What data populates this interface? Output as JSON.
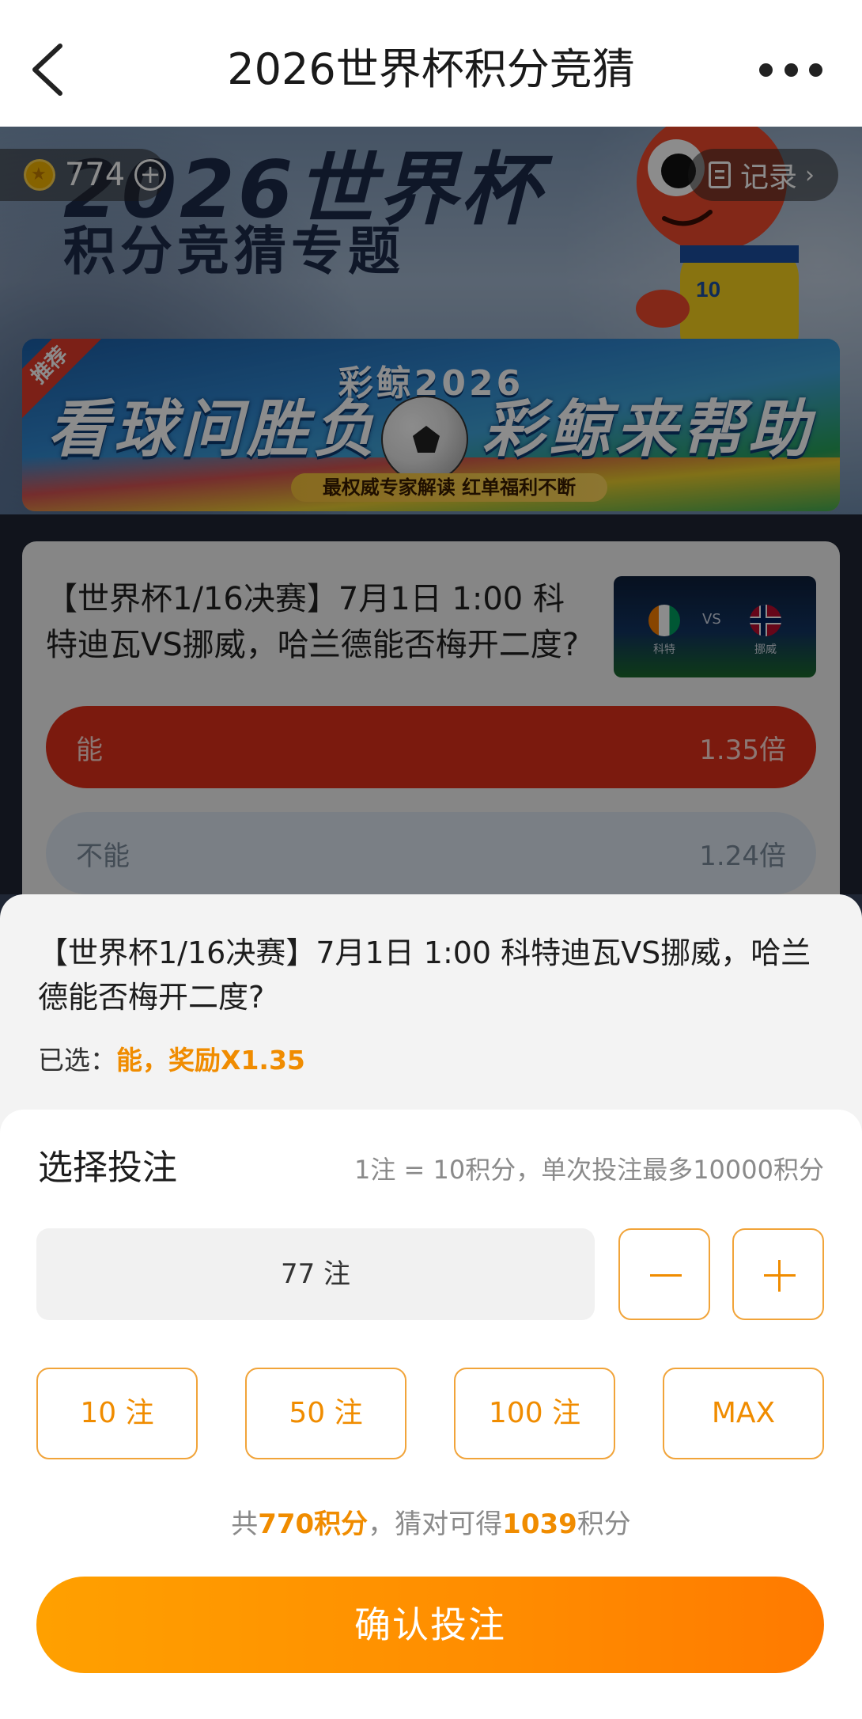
{
  "nav": {
    "title": "2026世界杯积分竞猜",
    "back_icon": "chevron-left-icon",
    "more_icon": "more-horizontal-icon"
  },
  "hero": {
    "points": "774",
    "record_label": "记录",
    "title_line1": "2026世界杯",
    "title_line2": "积分竞猜专题",
    "banner_tag": "推荐",
    "banner_sub": "彩鲸2026",
    "banner_main_left": "看球问胜负",
    "banner_main_right": "彩鲸来帮助",
    "banner_pill": "最权威专家解读 红单福利不断"
  },
  "question_card": {
    "title": "【世界杯1/16决赛】7月1日 1:00 科特迪瓦VS挪威，哈兰德能否梅开二度?",
    "thumb_vs": "VS",
    "thumb_team1": "科特",
    "thumb_team2": "挪威",
    "options": [
      {
        "label": "能",
        "odds": "1.35倍"
      },
      {
        "label": "不能",
        "odds": "1.24倍"
      }
    ]
  },
  "sheet": {
    "question": "【世界杯1/16决赛】7月1日 1:00 科特迪瓦VS挪威，哈兰德能否梅开二度?",
    "selected_prefix": "已选：",
    "selected_value": "能，奖励X1.35",
    "section_title": "选择投注",
    "rule": "1注 = 10积分，单次投注最多10000积分",
    "quantity": "77 注",
    "quick_options": [
      "10 注",
      "50 注",
      "100 注",
      "MAX"
    ],
    "summary_prefix": "共",
    "summary_cost": "770积分",
    "summary_mid": "，猜对可得",
    "summary_win": "1039",
    "summary_suffix": "积分",
    "confirm_label": "确认投注"
  },
  "colors": {
    "accent": "#f08c00",
    "confirm_start": "#ffa000",
    "confirm_end": "#ff7a00",
    "option_selected": "#e1301a",
    "option_unselected": "#dfe8f2"
  }
}
